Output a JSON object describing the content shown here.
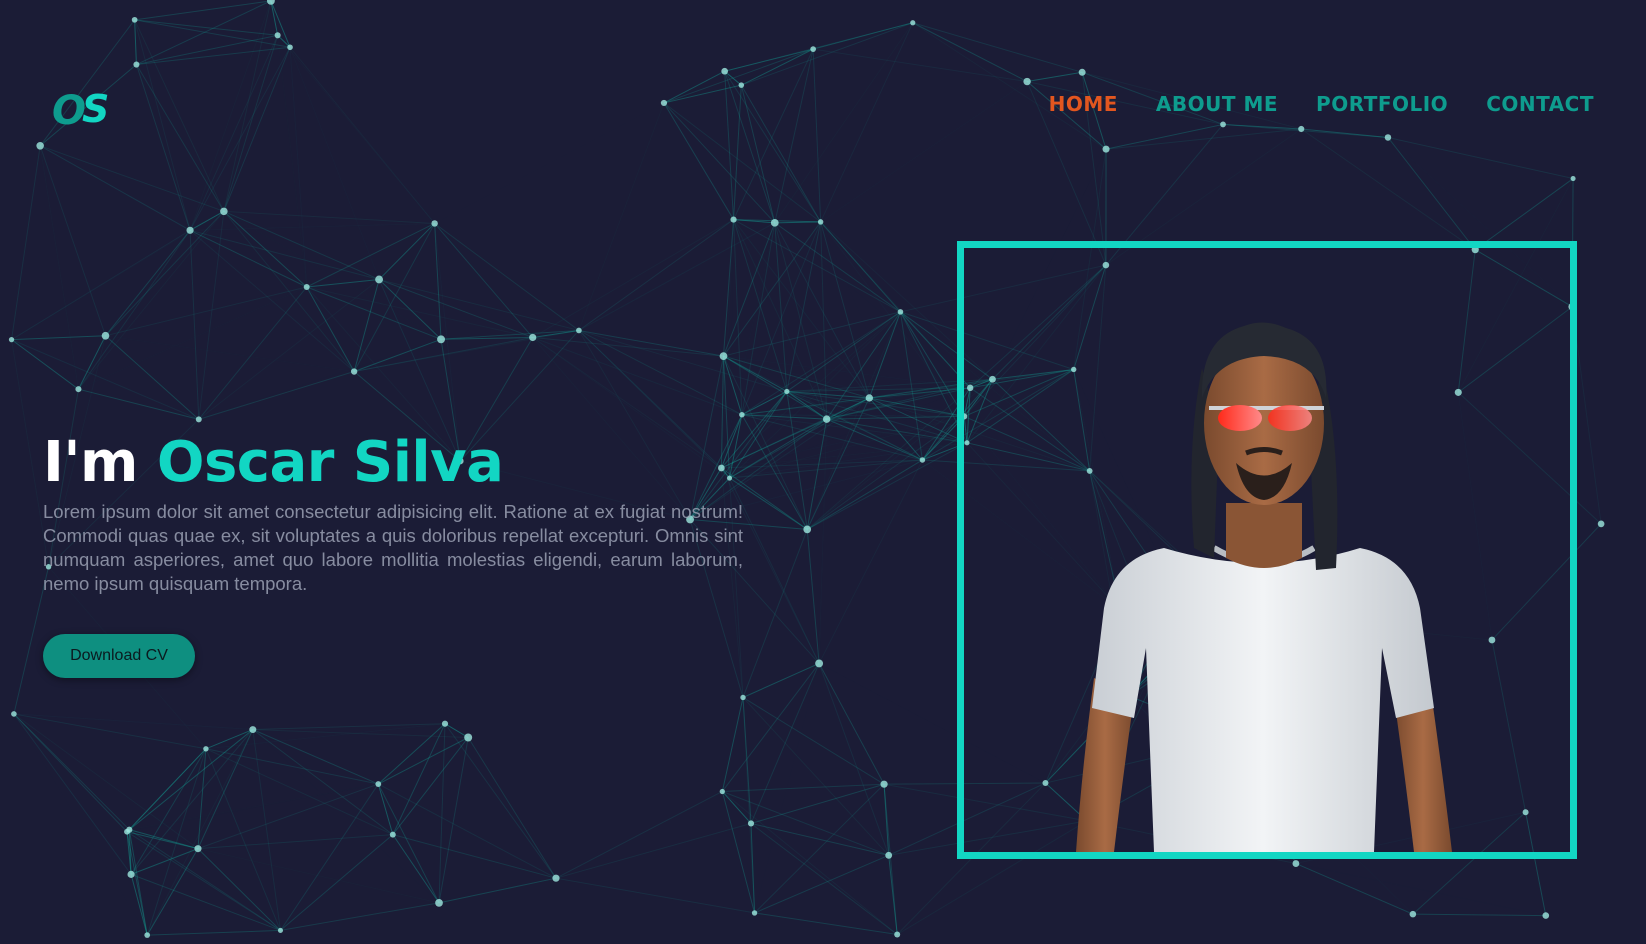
{
  "logo": {
    "initial_o": "O",
    "initial_s": "S"
  },
  "nav": {
    "items": [
      {
        "label": "HOME",
        "active": true
      },
      {
        "label": "ABOUT ME",
        "active": false
      },
      {
        "label": "PORTFOLIO",
        "active": false
      },
      {
        "label": "CONTACT",
        "active": false
      }
    ]
  },
  "hero": {
    "greeting": "I'm",
    "name": "Oscar Silva",
    "description": "Lorem ipsum dolor sit amet consectetur adipisicing elit. Ratione at ex fugiat nostrum! Commodi quas quae ex, sit voluptates a quis doloribus repellat excepturi. Omnis sint numquam asperiores, amet quo labore mollitia molestias eligendi, earum laborum, nemo ipsum quisquam tempora.",
    "button_label": "Download CV"
  },
  "colors": {
    "background": "#1b1c36",
    "accent": "#12d6c3",
    "nav_active": "#e2561f",
    "nav": "#0e9c8e"
  },
  "icons": [
    "logo-os-icon",
    "avatar-portrait"
  ]
}
